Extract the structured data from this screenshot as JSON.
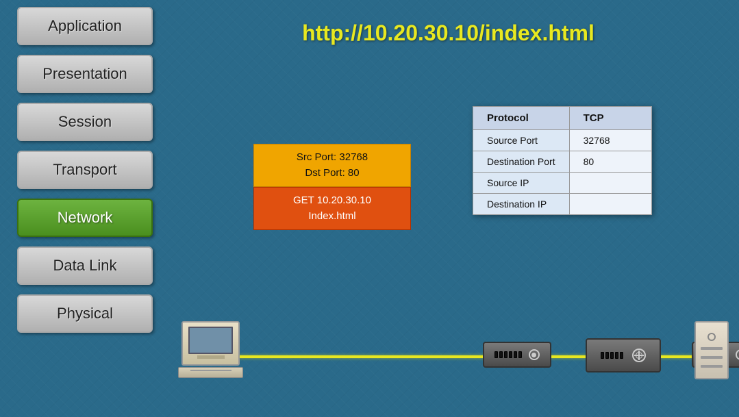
{
  "header": {
    "url": "http://10.20.30.10/index.html"
  },
  "sidebar": {
    "layers": [
      {
        "id": "application",
        "label": "Application",
        "active": false
      },
      {
        "id": "presentation",
        "label": "Presentation",
        "active": false
      },
      {
        "id": "session",
        "label": "Session",
        "active": false
      },
      {
        "id": "transport",
        "label": "Transport",
        "active": false
      },
      {
        "id": "network",
        "label": "Network",
        "active": true
      },
      {
        "id": "data-link",
        "label": "Data Link",
        "active": false
      },
      {
        "id": "physical",
        "label": "Physical",
        "active": false
      }
    ]
  },
  "packet": {
    "src_port_label": "Src Port: 32768",
    "dst_port_label": "Dst Port: 80",
    "http_line1": "GET 10.20.30.10",
    "http_line2": "Index.html"
  },
  "table": {
    "headers": [
      "Protocol",
      "TCP"
    ],
    "rows": [
      {
        "label": "Source Port",
        "value": "32768"
      },
      {
        "label": "Destination Port",
        "value": "80"
      },
      {
        "label": "Source IP",
        "value": ""
      },
      {
        "label": "Destination IP",
        "value": ""
      }
    ]
  },
  "colors": {
    "url_yellow": "#e8e820",
    "network_green": "#5a9a20",
    "packet_orange": "#f0a500",
    "packet_red": "#e05010",
    "cable_yellow": "#e8e820"
  }
}
